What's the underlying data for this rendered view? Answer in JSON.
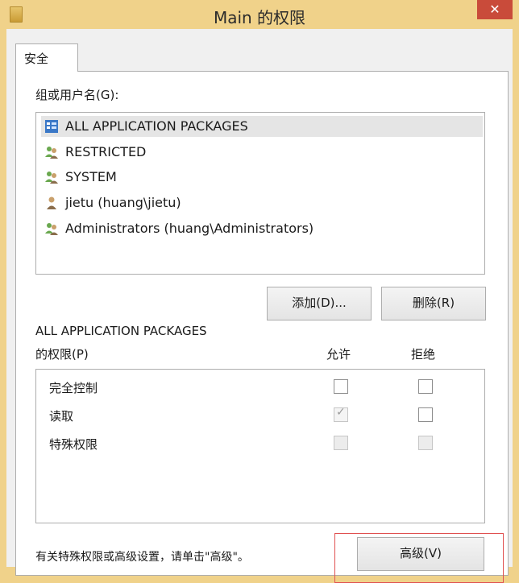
{
  "window": {
    "title": "Main 的权限",
    "close_glyph": "✕",
    "app_icon": "folder-icon"
  },
  "tabs": [
    {
      "label": "安全",
      "selected": true
    }
  ],
  "groups_label": "组或用户名(G):",
  "users": [
    {
      "name": "ALL APPLICATION PACKAGES",
      "icon": "app-packages-icon",
      "selected": true
    },
    {
      "name": "RESTRICTED",
      "icon": "user-group-icon",
      "selected": false
    },
    {
      "name": "SYSTEM",
      "icon": "user-group-icon",
      "selected": false
    },
    {
      "name": "jietu (huang\\jietu)",
      "icon": "user-icon",
      "selected": false
    },
    {
      "name": "Administrators (huang\\Administrators)",
      "icon": "user-group-icon",
      "selected": false
    }
  ],
  "buttons": {
    "add": "添加(D)...",
    "remove": "删除(R)",
    "advanced": "高级(V)"
  },
  "permissions": {
    "for_label": "ALL APPLICATION PACKAGES",
    "title_label": "的权限(P)",
    "allow_header": "允许",
    "deny_header": "拒绝",
    "items": [
      {
        "name": "完全控制",
        "allow": false,
        "deny": false,
        "allow_disabled": false,
        "deny_disabled": false
      },
      {
        "name": "读取",
        "allow": true,
        "deny": false,
        "allow_disabled": true,
        "deny_disabled": false
      },
      {
        "name": "特殊权限",
        "allow": false,
        "deny": false,
        "allow_disabled": true,
        "deny_disabled": true
      }
    ]
  },
  "footer_text": "有关特殊权限或高级设置，请单击\"高级\"。",
  "colors": {
    "title_bar": "#f0d28a",
    "close_button": "#c94b3a",
    "highlight_box": "#e05050"
  }
}
